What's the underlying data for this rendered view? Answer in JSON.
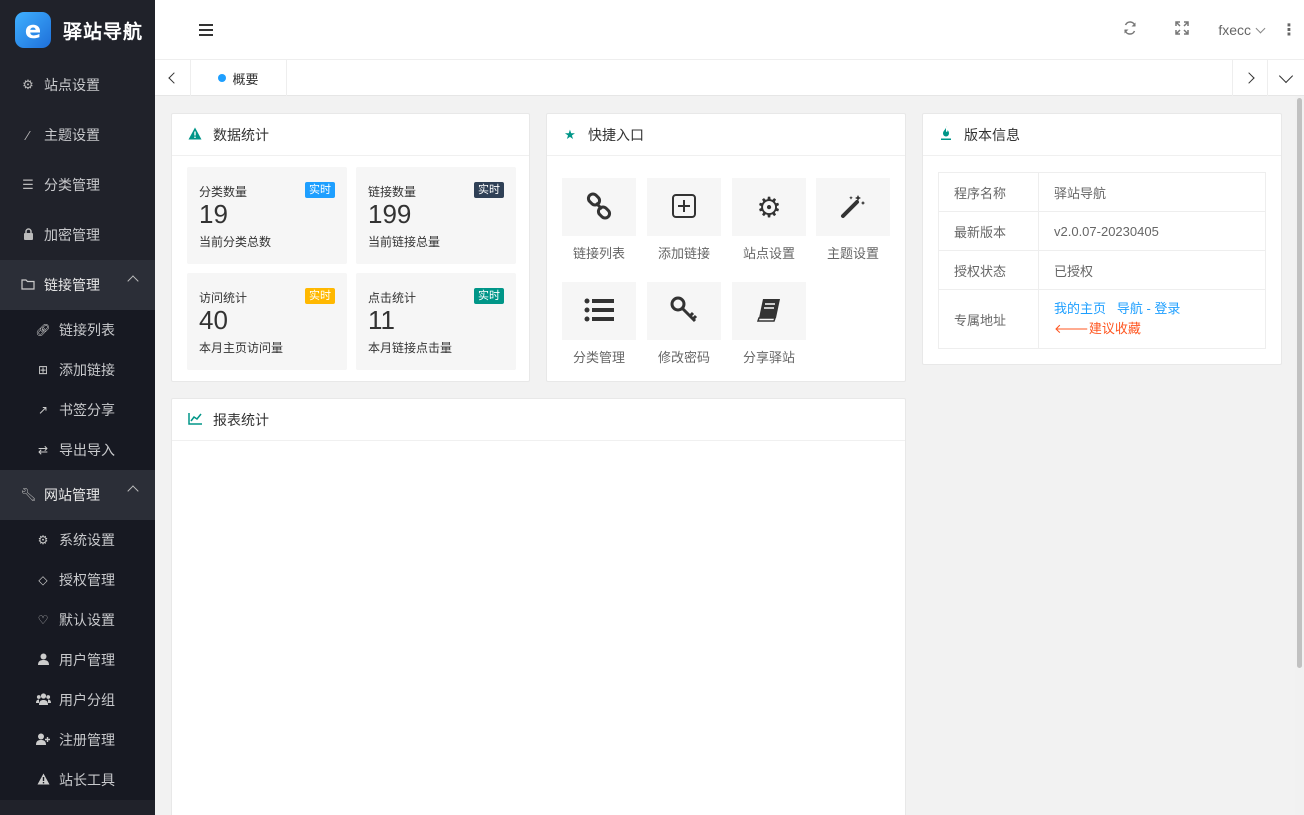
{
  "brand": {
    "logo_letter": "e",
    "name": "驿站导航"
  },
  "sidebar": {
    "items": [
      {
        "label": "站点设置",
        "icon": "gear-icon"
      },
      {
        "label": "主题设置",
        "icon": "wand-icon"
      },
      {
        "label": "分类管理",
        "icon": "list-icon"
      },
      {
        "label": "加密管理",
        "icon": "lock-icon"
      },
      {
        "label": "链接管理",
        "icon": "folder-icon"
      },
      {
        "label": "网站管理",
        "icon": "wrench-icon"
      }
    ],
    "links_sub": [
      {
        "label": "链接列表",
        "icon": "link-icon"
      },
      {
        "label": "添加链接",
        "icon": "plus-square-icon"
      },
      {
        "label": "书签分享",
        "icon": "external-link-icon"
      },
      {
        "label": "导出导入",
        "icon": "retweet-icon"
      }
    ],
    "site_sub": [
      {
        "label": "系统设置",
        "icon": "cogs-icon"
      },
      {
        "label": "授权管理",
        "icon": "diamond-icon"
      },
      {
        "label": "默认设置",
        "icon": "heart-icon"
      },
      {
        "label": "用户管理",
        "icon": "user-icon"
      },
      {
        "label": "用户分组",
        "icon": "users-icon"
      },
      {
        "label": "注册管理",
        "icon": "user-plus-icon"
      },
      {
        "label": "站长工具",
        "icon": "warning-icon"
      }
    ]
  },
  "header": {
    "user": "fxecc"
  },
  "tabs": {
    "home": "概要"
  },
  "stats_card": {
    "title": "数据统计",
    "items": [
      {
        "label": "分类数量",
        "badge": "实时",
        "badge_color": "#1e9fff",
        "value": "19",
        "sub": "当前分类总数"
      },
      {
        "label": "链接数量",
        "badge": "实时",
        "badge_color": "#2f4056",
        "value": "199",
        "sub": "当前链接总量"
      },
      {
        "label": "访问统计",
        "badge": "实时",
        "badge_color": "#ffb800",
        "value": "40",
        "sub": "本月主页访问量"
      },
      {
        "label": "点击统计",
        "badge": "实时",
        "badge_color": "#009688",
        "value": "11",
        "sub": "本月链接点击量"
      }
    ]
  },
  "quick_card": {
    "title": "快捷入口",
    "items": [
      {
        "label": "链接列表",
        "icon": "link-icon"
      },
      {
        "label": "添加链接",
        "icon": "plus-square-icon"
      },
      {
        "label": "站点设置",
        "icon": "gear-icon"
      },
      {
        "label": "主题设置",
        "icon": "wand-icon"
      },
      {
        "label": "分类管理",
        "icon": "list-icon"
      },
      {
        "label": "修改密码",
        "icon": "key-icon"
      },
      {
        "label": "分享驿站",
        "icon": "book-icon"
      }
    ]
  },
  "version_card": {
    "title": "版本信息",
    "rows": [
      {
        "key": "程序名称",
        "value": "驿站导航"
      },
      {
        "key": "最新版本",
        "value": "v2.0.07-20230405"
      },
      {
        "key": "授权状态",
        "value": "已授权"
      }
    ],
    "address_key": "专属地址",
    "link_home": "我的主页",
    "link_nav": "导航 - 登录",
    "link_bookmark": "建议收藏"
  },
  "report_card": {
    "title": "报表统计"
  },
  "colors": {
    "accent": "#009688",
    "blue": "#1e9fff",
    "red": "#ff5722",
    "sidebar_bg": "#20222a"
  }
}
